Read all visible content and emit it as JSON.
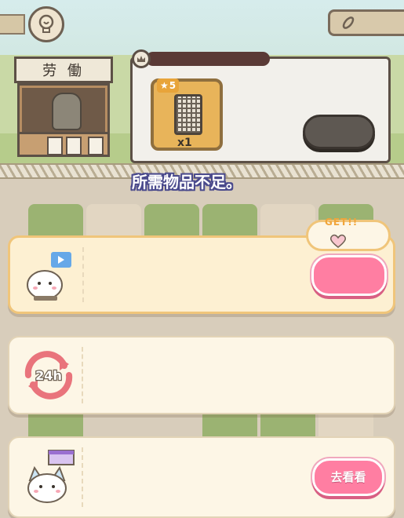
{
  "stall": {
    "sign": "劳 働"
  },
  "item": {
    "star_level": "5",
    "quantity": "x1"
  },
  "toast": "所需物品不足。",
  "offers": [
    {
      "kind": "video",
      "badge": "GET!!",
      "button_label": ""
    },
    {
      "kind": "24h",
      "badge_text": "24h"
    },
    {
      "kind": "shop",
      "button_label": "去看看"
    }
  ],
  "colors": {
    "accent_pink": "#ff7ea2",
    "card_bg": "#fdf6e6",
    "highlight_border": "#f0c57a"
  }
}
